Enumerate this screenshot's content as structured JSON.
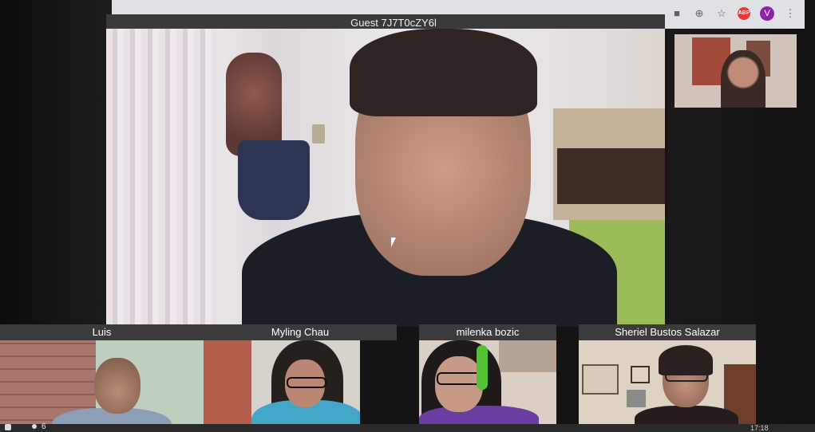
{
  "browser": {
    "icons": [
      "camera-icon",
      "zoom-icon",
      "star-icon",
      "abp-icon",
      "profile-avatar",
      "menu-icon"
    ],
    "abp_label": "ABP",
    "profile_initial": "V"
  },
  "main_video": {
    "participant_name": "Guest 7J7T0cZY6l"
  },
  "thumbnails": [
    {
      "name": "Luis"
    },
    {
      "name": "Myling Chau"
    },
    {
      "name": "milenka bozic"
    },
    {
      "name": "Sheriel Bustos Salazar"
    }
  ],
  "status_bar": {
    "participant_count": "6",
    "time": "17:18"
  }
}
